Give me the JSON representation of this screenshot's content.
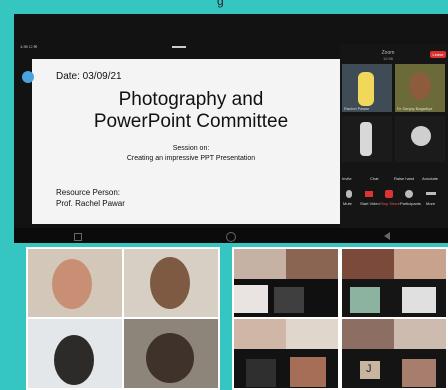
{
  "top_caption": "g",
  "tablet": {
    "status_left": "1:39 ☐ ✉",
    "zoom_label": "Zoom",
    "zoom_sub": "10:56",
    "leave_label": "Leave",
    "slide": {
      "date": "Date: 03/09/21",
      "title_line1": "Photography and",
      "title_line2": "PowerPoint Committee",
      "session_label": "Session on:",
      "session_topic": "Creating an impressive PPT Presentation",
      "rp_label": "Resource Person:",
      "rp_name": "Prof. Rachel Pawar"
    },
    "participants": [
      {
        "name": "Rachel Pawar"
      },
      {
        "name": "Dr Sanjay Bagadiya"
      },
      {
        "name": ""
      },
      {
        "name": ""
      }
    ],
    "controls": [
      "Mute",
      "Start Video",
      "Stop Share",
      "Participants",
      "More"
    ],
    "controls_row2": [
      "Invite",
      "Chat",
      "Raise hand",
      "Annotate"
    ]
  },
  "gallery_right_letter": "J"
}
